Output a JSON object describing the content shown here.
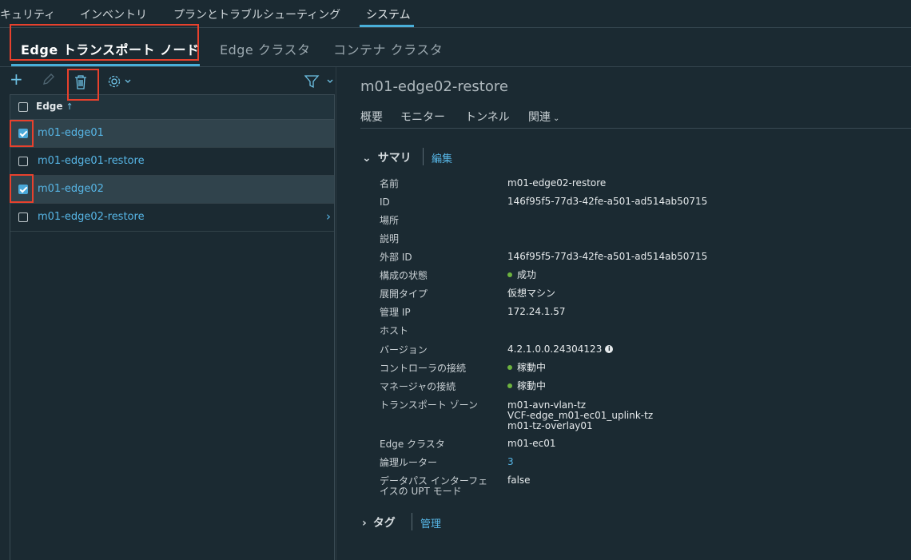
{
  "topnav": {
    "items": [
      "キュリティ",
      "インベントリ",
      "プランとトラブルシューティング",
      "システム"
    ]
  },
  "subtabs": [
    "Edge トランスポート ノード",
    "Edge クラスタ",
    "コンテナ クラスタ"
  ],
  "toolbar": {
    "add": "add-icon",
    "edit": "edit-icon",
    "delete": "trash-icon",
    "settings": "gear-icon",
    "filter": "filter-icon"
  },
  "grid": {
    "column": "Edge",
    "sort": "↑",
    "rows": [
      {
        "name": "m01-edge01",
        "checked": true
      },
      {
        "name": "m01-edge01-restore",
        "checked": false
      },
      {
        "name": "m01-edge02",
        "checked": true
      },
      {
        "name": "m01-edge02-restore",
        "checked": false
      }
    ]
  },
  "detail": {
    "title": "m01-edge02-restore",
    "tabs": [
      "概要",
      "モニター",
      "トンネル",
      "関連"
    ],
    "summary": {
      "title": "サマリ",
      "link": "編集"
    },
    "props": {
      "name_label": "名前",
      "name_value": "m01-edge02-restore",
      "id_label": "ID",
      "id_value": "146f95f5-77d3-42fe-a501-ad514ab50715",
      "location_label": "場所",
      "desc_label": "説明",
      "extid_label": "外部 ID",
      "extid_value": "146f95f5-77d3-42fe-a501-ad514ab50715",
      "config_label": "構成の状態",
      "config_value": "成功",
      "deploy_label": "展開タイプ",
      "deploy_value": "仮想マシン",
      "mgmtip_label": "管理 IP",
      "mgmtip_value": "172.24.1.57",
      "host_label": "ホスト",
      "version_label": "バージョン",
      "version_value": "4.2.1.0.0.24304123",
      "ctrl_label": "コントローラの接続",
      "ctrl_value": "稼動中",
      "mgr_label": "マネージャの接続",
      "mgr_value": "稼動中",
      "tz_label": "トランスポート ゾーン",
      "tz_values": [
        "m01-avn-vlan-tz",
        "VCF-edge_m01-ec01_uplink-tz",
        "m01-tz-overlay01"
      ],
      "cluster_label": "Edge クラスタ",
      "cluster_value": "m01-ec01",
      "router_label": "論理ルーター",
      "router_value": "3",
      "upt_label_1": "データパス インターフェ",
      "upt_label_2": "イスの UPT モード",
      "upt_value": "false"
    },
    "tags": {
      "title": "タグ",
      "link": "管理"
    }
  },
  "colors": {
    "accent": "#49afd9",
    "link": "#57b6e6",
    "highlight": "#e8412d",
    "ok": "#6db33f"
  }
}
